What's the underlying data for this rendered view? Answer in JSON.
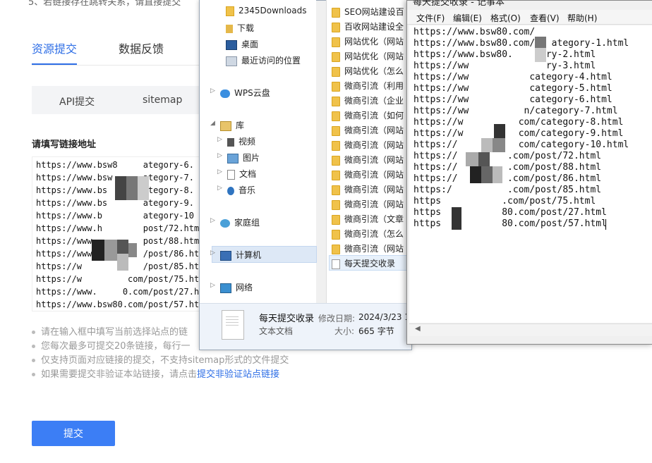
{
  "web": {
    "top_note": "5、若链接存在跳转关系，请直接提交",
    "tabs": [
      {
        "label": "资源提交"
      },
      {
        "label": "数据反馈"
      }
    ],
    "subtabs": [
      {
        "label": "API提交"
      },
      {
        "label": "sitemap"
      }
    ],
    "section_title": "请填写链接地址",
    "url_lines": [
      "https://www.bsw8     ategory-6.",
      "https://www.bsw      ategory-7.",
      "https://www.bs       ategory-8.",
      "https://www.bs       ategory-9.",
      "https://www.b        ategory-10",
      "https://www.h        post/72.htm",
      "https://www          post/88.htm",
      "https://www          /post/86.htm",
      "https://w            /post/85.htm",
      "https://w         com/post/75.htm",
      "https://www.     0.com/post/27.htm",
      "https://www.bsw80.com/post/57.htm"
    ],
    "notes": [
      "请在输入框中填写当前选择站点的链",
      "您每次最多可提交20条链接，每行一",
      "仅支持页面对应链接的提交，不支持sitemap形式的文件提交",
      "如果需要提交非验证本站链接，请点击"
    ],
    "note_link": "提交非验证站点链接",
    "submit_label": "提交"
  },
  "explorer": {
    "nav_items": [
      {
        "label": "2345Downloads",
        "icon": "folder-icon"
      },
      {
        "label": "下载",
        "icon": "download-folder-icon"
      },
      {
        "label": "桌面",
        "icon": "desktop-icon"
      },
      {
        "label": "最近访问的位置",
        "icon": "recent-places-icon"
      },
      {
        "label": "WPS云盘",
        "icon": "cloud-icon"
      },
      {
        "label": "库",
        "icon": "library-icon"
      },
      {
        "label": "视频",
        "icon": "video-icon"
      },
      {
        "label": "图片",
        "icon": "picture-icon"
      },
      {
        "label": "文档",
        "icon": "document-icon"
      },
      {
        "label": "音乐",
        "icon": "music-icon"
      },
      {
        "label": "家庭组",
        "icon": "homegroup-icon"
      },
      {
        "label": "计算机",
        "icon": "computer-icon"
      },
      {
        "label": "网络",
        "icon": "network-icon"
      }
    ],
    "files": [
      "SEO网站建设百",
      "百收网站建设全",
      "网站优化（网站",
      "网站优化（网站",
      "网站优化（怎么",
      "微商引流（利用",
      "微商引流（企业",
      "微商引流（如何",
      "微商引流（网站",
      "微商引流（网站",
      "微商引流（网站",
      "微商引流（网站",
      "微商引流（网站",
      "微商引流（网站",
      "微商引流（文章",
      "微商引流（怎么",
      "微商引流（网站"
    ],
    "selected_file": "每天提交收录",
    "details": {
      "name": "每天提交收录",
      "modified_label": "修改日期:",
      "modified_value": "2024/3/23 1",
      "type": "文本文档",
      "size_label": "大小:",
      "size_value": "665 字节"
    }
  },
  "notepad": {
    "title": "每天提交收录 - 记事本",
    "menus": [
      "文件(F)",
      "编辑(E)",
      "格式(O)",
      "查看(V)",
      "帮助(H)"
    ],
    "lines": [
      "https://www.bsw80.com/",
      "https://www.bsw80.com/   ategory-1.html",
      "https://www.bsw80.      ry-2.html",
      "https://ww              ry-3.html",
      "https://ww           category-4.html",
      "https://ww           category-5.html",
      "https://ww           category-6.html",
      "https://ww          n/category-7.html",
      "https://w          com/category-8.html",
      "https://w          com/category-9.html",
      "https://           com/category-10.html",
      "https://         .com/post/72.html",
      "https://         .com/post/88.html",
      "https://         .com/post/86.html",
      "https:/          .com/post/85.html",
      "https           .com/post/75.html",
      "https           80.com/post/27.html",
      "https           80.com/post/57.html"
    ]
  }
}
